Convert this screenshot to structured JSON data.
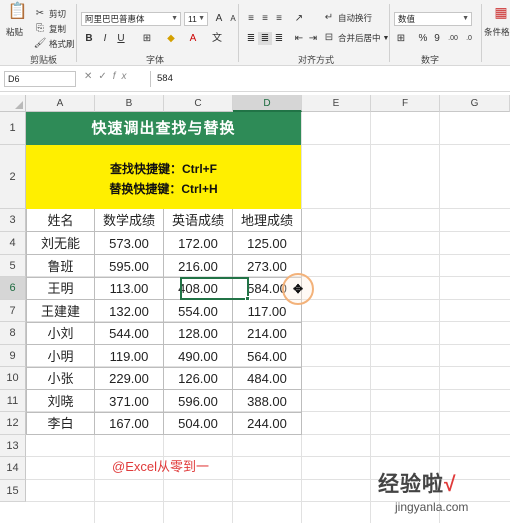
{
  "ribbon": {
    "clipboard": {
      "paste": "粘贴",
      "cut": "剪切",
      "copy": "复制",
      "format_painter": "格式刷",
      "group_label": "剪贴板"
    },
    "font": {
      "name": "阿里巴巴普惠体",
      "size": "11",
      "group_label": "字体"
    },
    "alignment": {
      "wrap_text": "自动换行",
      "merge_center": "合并后居中",
      "group_label": "对齐方式"
    },
    "number": {
      "format": "数值",
      "group_label": "数字"
    },
    "styles": {
      "conditional": "条件格式"
    }
  },
  "formula_bar": {
    "name_box": "D6",
    "fx": "fx",
    "content": "584"
  },
  "columns": [
    "A",
    "B",
    "C",
    "D",
    "E",
    "F",
    "G"
  ],
  "rows": [
    "1",
    "2",
    "3",
    "4",
    "5",
    "6",
    "7",
    "8",
    "9",
    "10",
    "11",
    "12",
    "13",
    "14",
    "15"
  ],
  "title": "快速调出查找与替换",
  "shortcuts": [
    "查找快捷键：Ctrl+F",
    "替换快捷键：Ctrl+H"
  ],
  "table": {
    "headers": [
      "姓名",
      "数学成绩",
      "英语成绩",
      "地理成绩"
    ],
    "rows": [
      [
        "刘无能",
        "573.00",
        "172.00",
        "125.00"
      ],
      [
        "鲁班",
        "595.00",
        "216.00",
        "273.00"
      ],
      [
        "王明",
        "113.00",
        "408.00",
        "584.00"
      ],
      [
        "王建建",
        "132.00",
        "554.00",
        "117.00"
      ],
      [
        "小刘",
        "544.00",
        "128.00",
        "214.00"
      ],
      [
        "小明",
        "119.00",
        "490.00",
        "564.00"
      ],
      [
        "小张",
        "229.00",
        "126.00",
        "484.00"
      ],
      [
        "刘晓",
        "371.00",
        "596.00",
        "388.00"
      ],
      [
        "李白",
        "167.00",
        "504.00",
        "244.00"
      ]
    ]
  },
  "watermarks": {
    "author": "@Excel从零到一",
    "site": "经验啦",
    "check": "√",
    "url": "jingyanla.com"
  }
}
